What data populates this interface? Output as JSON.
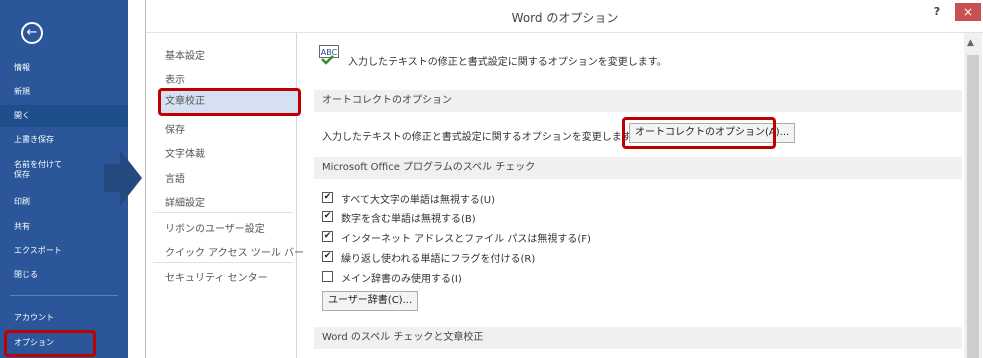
{
  "backstage": {
    "items": [
      {
        "label": "情報"
      },
      {
        "label": "新規"
      },
      {
        "label": "開く"
      },
      {
        "label": "上書き保存"
      },
      {
        "label": "名前を付けて\n保存"
      },
      {
        "label": "印刷"
      },
      {
        "label": "共有"
      },
      {
        "label": "エクスポート"
      },
      {
        "label": "閉じる"
      },
      {
        "label": "アカウント"
      },
      {
        "label": "オプション"
      }
    ]
  },
  "dialog": {
    "title": "Word のオプション",
    "help": "?",
    "close": "×",
    "nav": [
      "基本設定",
      "表示",
      "文章校正",
      "保存",
      "文字体裁",
      "言語",
      "詳細設定",
      "リボンのユーザー設定",
      "クイック アクセス ツール バー",
      "セキュリティ センター"
    ],
    "intro_icon_text": "ABC",
    "intro": "入力したテキストの修正と書式設定に関するオプションを変更します。",
    "autocorrect": {
      "header": "オートコレクトのオプション",
      "text": "入力したテキストの修正と書式設定に関するオプションを変更します。",
      "button": "オートコレクトのオプション(A)..."
    },
    "spell": {
      "header": "Microsoft Office プログラムのスペル チェック",
      "options": [
        {
          "label": "すべて大文字の単語は無視する(U)",
          "checked": true
        },
        {
          "label": "数字を含む単語は無視する(B)",
          "checked": true
        },
        {
          "label": "インターネット アドレスとファイル パスは無視する(F)",
          "checked": true
        },
        {
          "label": "繰り返し使われる単語にフラグを付ける(R)",
          "checked": true
        },
        {
          "label": "メイン辞書のみ使用する(I)",
          "checked": false
        }
      ],
      "dict_button": "ユーザー辞書(C)..."
    },
    "word_header": "Word のスペル チェックと文章校正"
  },
  "colors": {
    "backstage": "#2b579a",
    "highlight": "#c00000",
    "selected": "#d5e1f2"
  }
}
